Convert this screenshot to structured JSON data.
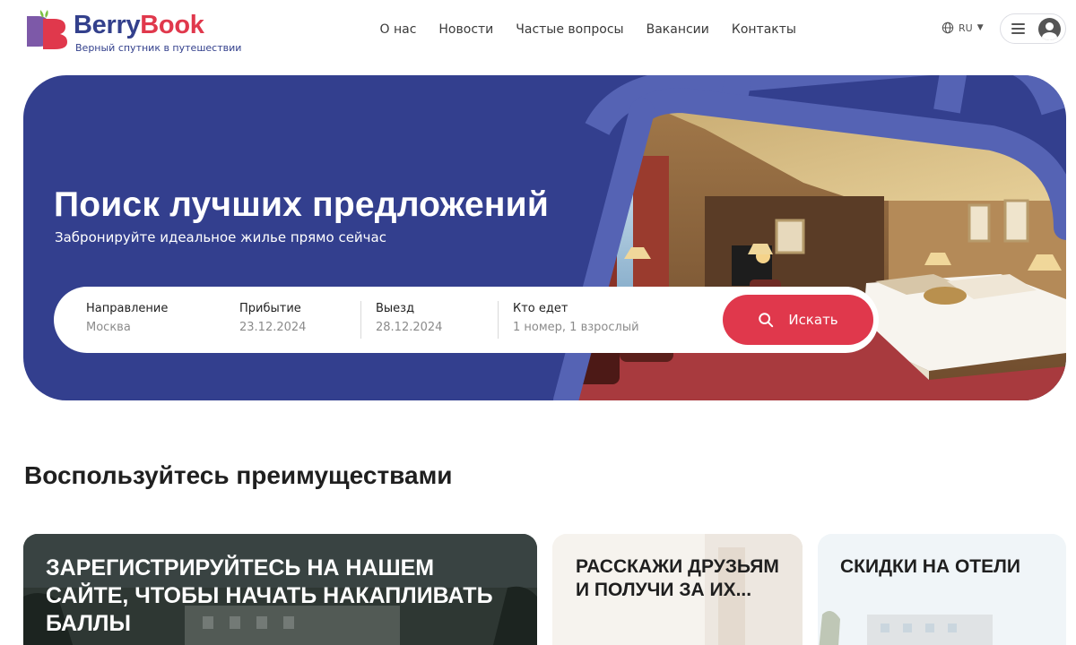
{
  "brand": {
    "name_part1": "Berry",
    "name_part2": "Book",
    "tagline": "Верный спутник в путешествии",
    "colors": {
      "navy": "#333f8e",
      "red": "#e0384c",
      "green": "#7cc142"
    }
  },
  "nav": {
    "items": [
      "О нас",
      "Новости",
      "Частые вопросы",
      "Вакансии",
      "Контакты"
    ]
  },
  "header": {
    "language": "RU",
    "language_icon": "globe-icon",
    "menu_icon": "menu-icon",
    "avatar_icon": "user-avatar-icon"
  },
  "hero": {
    "title": "Поиск лучших предложений",
    "subtitle": "Забронируйте идеальное жилье прямо сейчас",
    "image": "hotel-bedroom-photo"
  },
  "search": {
    "destination": {
      "label": "Направление",
      "value": "Москва"
    },
    "checkin": {
      "label": "Прибытие",
      "value": "23.12.2024"
    },
    "checkout": {
      "label": "Выезд",
      "value": "28.12.2024"
    },
    "guests": {
      "label": "Кто едет",
      "value": "1 номер, 1 взрослый"
    },
    "button_label": "Искать",
    "button_icon": "search-icon"
  },
  "advantages": {
    "title": "Воспользуйтесь преимуществами",
    "cards": [
      {
        "title": "ЗАРЕГИСТРИРУЙТЕСЬ НА НАШЕМ САЙТЕ, ЧТОБЫ НАЧАТЬ НАКАПЛИВАТЬ БАЛЛЫ"
      },
      {
        "title": "РАССКАЖИ ДРУЗЬЯМ И ПОЛУЧИ ЗА ИХ..."
      },
      {
        "title": "СКИДКИ НА ОТЕЛИ"
      }
    ]
  }
}
